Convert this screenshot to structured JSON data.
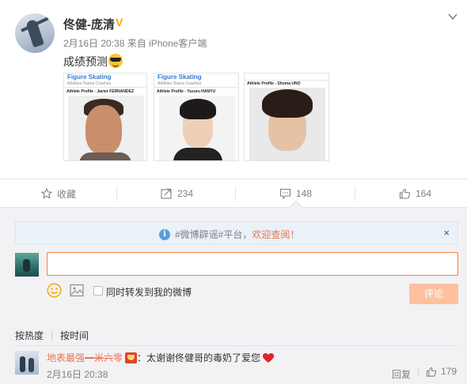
{
  "post": {
    "username": "佟健-庞清",
    "verified_badge": "V",
    "date": "2月16日 20:38",
    "source": "来自 iPhone客户端",
    "text": "成绩预测",
    "emoji": "cool-sunglasses-emoji",
    "photos": [
      {
        "logo": "Figure Skating",
        "nav": "Athletes   Teams   Coaches",
        "profile": "Athlete Profile - Javier FERNANDEZ"
      },
      {
        "logo": "Figure Skating",
        "nav": "Athletes   Teams   Coaches",
        "profile": "Athlete Profile - Yuzuru HANYU"
      },
      {
        "logo": "",
        "nav": "",
        "profile": "Athlete Profile - Shoma UNO"
      }
    ]
  },
  "actions": {
    "favorite": "收藏",
    "forward": "234",
    "comment": "148",
    "like": "164"
  },
  "notice": {
    "prefix": "#微博辟谣#平台，",
    "link": "欢迎查阅！",
    "close": "×"
  },
  "composer": {
    "input_value": "",
    "checkbox_label": "同时转发到我的微博",
    "submit": "评论"
  },
  "sort": {
    "hot": "按热度",
    "time": "按时间"
  },
  "comments": [
    {
      "user_pre": "地表最强",
      "user_struck": "一米六",
      "user_post": "零",
      "text": "：太谢谢佟健哥的毒奶了爱您",
      "time": "2月16日 20:38",
      "reply": "回复",
      "likes": "179"
    }
  ]
}
